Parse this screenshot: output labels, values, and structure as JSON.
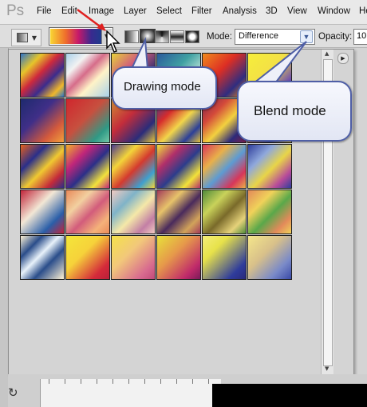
{
  "app": {
    "logo": "Ps"
  },
  "menu": [
    "File",
    "Edit",
    "Image",
    "Layer",
    "Select",
    "Filter",
    "Analysis",
    "3D",
    "View",
    "Window",
    "He"
  ],
  "options": {
    "mode_label": "Mode:",
    "mode_value": "Difference",
    "opacity_label": "Opacity:",
    "opacity_value": "10"
  },
  "callouts": {
    "drawing_mode": "Drawing mode",
    "blend_mode": "Blend mode"
  },
  "gradients": [
    {
      "row": 0,
      "col": 0,
      "css": "linear-gradient(135deg,#2d74c9 0%,#e6c52a 25%,#cf2a3c 45%,#3b2c8d 65%,#f0b82b 85%,#2d74c9 100%)"
    },
    {
      "row": 0,
      "col": 1,
      "css": "linear-gradient(135deg,#a8d0ea 0%,#f2f2f2 25%,#d66c8a 45%,#fff3c7 65%,#a8d0ea 100%)"
    },
    {
      "row": 0,
      "col": 2,
      "css": "linear-gradient(135deg,#e7d23a 0%,#d15e7a 35%,#2a2b6e 70%,#c9c6d6 100%)"
    },
    {
      "row": 0,
      "col": 3,
      "css": "linear-gradient(135deg,#2a5a9c 0%,#3fa0a2 40%,#b8e3d6 70%,#2a5a9c 100%)"
    },
    {
      "row": 0,
      "col": 4,
      "css": "linear-gradient(135deg,#f08a1c 0%,#dd2e24 40%,#2f2d80 75%,#f08a1c 100%)"
    },
    {
      "row": 0,
      "col": 5,
      "css": "linear-gradient(135deg,#f6ee3a 0%,#f3e046 45%,#6a4ab0 80%,#f6ee3a 100%)"
    },
    {
      "row": 1,
      "col": 0,
      "css": "linear-gradient(135deg,#1e2a6e 0%,#402f88 40%,#d45a3c 75%,#f2a23c 100%)"
    },
    {
      "row": 1,
      "col": 1,
      "css": "linear-gradient(135deg,#d0262d 0%,#c7503f 45%,#2f9a86 80%,#75c9a8 100%)"
    },
    {
      "row": 1,
      "col": 2,
      "css": "linear-gradient(135deg,#cf8b33 0%,#c42d3b 40%,#2b2c7a 75%,#e8c93a 100%)"
    },
    {
      "row": 1,
      "col": 3,
      "css": "linear-gradient(135deg,#2c3f98 0%,#d62c2c 30%,#f2d64a 55%,#2c3f98 80%,#e6c33a 100%)"
    },
    {
      "row": 1,
      "col": 4,
      "css": "linear-gradient(135deg,#7a1f4a 0%,#d44a3a 30%,#f3d13f 55%,#2d2a7a 80%,#7a1f4a 100%)"
    },
    {
      "row": 1,
      "col": 5,
      "css": "linear-gradient(135deg,#f2cf2e 0%,#e08430 40%,#2a3a9a 75%,#f2cf2e 100%)"
    },
    {
      "row": 2,
      "col": 0,
      "css": "linear-gradient(135deg,#e6601d 0%,#2a2f8a 30%,#f0c931 55%,#c42a3a 80%,#2a2f8a 100%)"
    },
    {
      "row": 2,
      "col": 1,
      "css": "linear-gradient(135deg,#f2b02b 0%,#c0267a 30%,#2b2f88 55%,#f2e23c 80%,#c0267a 100%)"
    },
    {
      "row": 2,
      "col": 2,
      "css": "linear-gradient(135deg,#4b3a8e 0%,#f3d43a 30%,#d43a2f 55%,#3f9fcf 80%,#f3d43a 100%)"
    },
    {
      "row": 2,
      "col": 3,
      "css": "linear-gradient(135deg,#f2e23a 0%,#b12f6a 30%,#2c3c8c 55%,#f2e23a 80%,#b12f6a 100%)"
    },
    {
      "row": 2,
      "col": 4,
      "css": "linear-gradient(135deg,#d7365a 0%,#e9b04a 30%,#5d9bd2 55%,#d7365a 80%,#e9b04a 100%)"
    },
    {
      "row": 2,
      "col": 5,
      "css": "linear-gradient(135deg,#2f3e9c 0%,#8fa8dc 30%,#e8d548 55%,#b74a9a 80%,#2f3e9c 100%)"
    },
    {
      "row": 3,
      "col": 0,
      "css": "linear-gradient(135deg,#c1243a 0%,#f2e7d5 40%,#2b5fa9 75%,#c1243a 100%)"
    },
    {
      "row": 3,
      "col": 1,
      "css": "linear-gradient(135deg,#e98a5a 0%,#f2d0a0 30%,#d25c7b 55%,#f5b27a 80%,#e98a5a 100%)"
    },
    {
      "row": 3,
      "col": 2,
      "css": "linear-gradient(135deg,#f2cbc2 0%,#7fb3c8 30%,#f5e8a8 55%,#c37fa5 80%,#f2cbc2 100%)"
    },
    {
      "row": 3,
      "col": 3,
      "css": "linear-gradient(135deg,#a23a5a 0%,#e7c36a 30%,#4a2a5c 55%,#d2a35a 80%,#a23a5a 100%)"
    },
    {
      "row": 3,
      "col": 4,
      "css": "linear-gradient(135deg,#4f8a3a 0%,#c9d25a 30%,#7a6a2a 55%,#e6d27a 80%,#4f8a3a 100%)"
    },
    {
      "row": 3,
      "col": 5,
      "css": "linear-gradient(135deg,#e28a5a 0%,#f0d25a 30%,#5aa84a 55%,#e28a5a 80%,#f0d25a 100%)"
    },
    {
      "row": 4,
      "col": 0,
      "css": "linear-gradient(135deg,#fff3d5 0%,#2a4d8a 25%,#e8f2fa 45%,#2a4d8a 65%,#fff3d5 100%)"
    },
    {
      "row": 4,
      "col": 1,
      "css": "linear-gradient(135deg,#f4e63a 0%,#f6d23a 40%,#d42a3a 80%,#b8203a 100%)"
    },
    {
      "row": 4,
      "col": 2,
      "css": "linear-gradient(135deg,#f4e24a 0%,#f2c87a 40%,#d86b8f 80%,#c14a7a 100%)"
    },
    {
      "row": 4,
      "col": 3,
      "css": "linear-gradient(135deg,#e7e13a 0%,#e69a4a 40%,#c02a6a 80%,#7a1a5a 100%)"
    },
    {
      "row": 4,
      "col": 4,
      "css": "linear-gradient(135deg,#f4ee7a 0%,#e7e24a 30%,#2f3c9c 80%,#2a2a7a 100%)"
    },
    {
      "row": 4,
      "col": 5,
      "css": "linear-gradient(135deg,#f4e68a 0%,#d8c08a 40%,#7a8ac8 75%,#3a4aa8 100%)"
    }
  ]
}
